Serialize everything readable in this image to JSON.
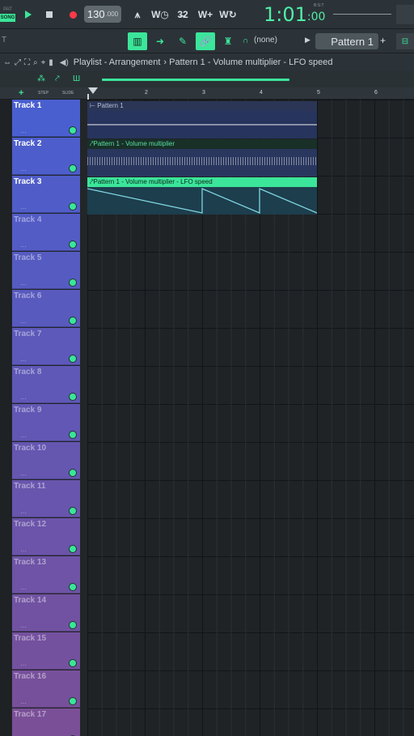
{
  "transport": {
    "pat_label": "PAT",
    "song_label": "SONG",
    "tempo": "130",
    "tempo_decimal": ".000",
    "time_main": "1:01",
    "time_sub": ":00",
    "time_format_label": "B:S:T"
  },
  "toolbar2": {
    "left_label": "T",
    "snap": "(none)",
    "pattern": "Pattern 1"
  },
  "titlebar": {
    "title": "Playlist - Arrangement",
    "crumbs": [
      "Pattern 1",
      "Volume multiplier",
      "LFO speed"
    ],
    "crumb_text": "› Pattern 1 - Volume multiplier - LFO speed"
  },
  "ruler": {
    "step_label": "STEP",
    "slide_label": "SLIDE",
    "bars": [
      "2",
      "3",
      "4",
      "5",
      "6"
    ]
  },
  "tracks": [
    {
      "name": "Track 1"
    },
    {
      "name": "Track 2"
    },
    {
      "name": "Track 3"
    },
    {
      "name": "Track 4"
    },
    {
      "name": "Track 5"
    },
    {
      "name": "Track 6"
    },
    {
      "name": "Track 7"
    },
    {
      "name": "Track 8"
    },
    {
      "name": "Track 9"
    },
    {
      "name": "Track 10"
    },
    {
      "name": "Track 11"
    },
    {
      "name": "Track 12"
    },
    {
      "name": "Track 13"
    },
    {
      "name": "Track 14"
    },
    {
      "name": "Track 15"
    },
    {
      "name": "Track 16"
    },
    {
      "name": "Track 17"
    }
  ],
  "clips": {
    "clip1": "Pattern 1",
    "clip2": "Pattern 1 - Volume multiplier",
    "clip3": "Pattern 1 - Volume multiplier - LFO speed"
  },
  "colors": {
    "accent": "#3be59a",
    "track_top": "#4a5fcf",
    "track_bottom": "#7a4f98"
  }
}
